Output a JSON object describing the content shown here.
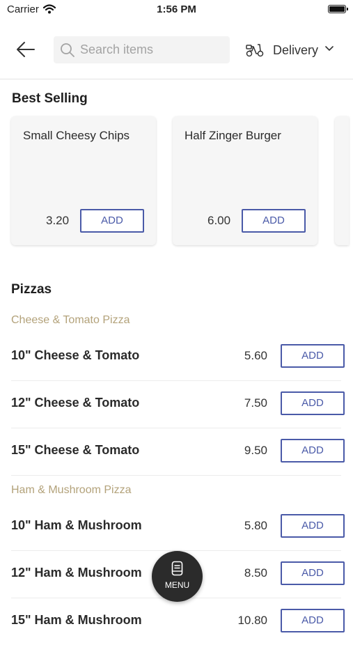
{
  "status_bar": {
    "carrier": "Carrier",
    "time": "1:56 PM"
  },
  "header": {
    "search_placeholder": "Search items",
    "delivery_label": "Delivery"
  },
  "best_selling": {
    "title": "Best Selling",
    "items": [
      {
        "name": "Small Cheesy Chips",
        "price": "3.20",
        "add_label": "ADD"
      },
      {
        "name": "Half Zinger Burger",
        "price": "6.00",
        "add_label": "ADD"
      }
    ]
  },
  "pizzas": {
    "title": "Pizzas",
    "groups": [
      {
        "name": "Cheese & Tomato Pizza",
        "items": [
          {
            "name": "10\" Cheese & Tomato",
            "price": "5.60",
            "add_label": "ADD"
          },
          {
            "name": "12\" Cheese & Tomato",
            "price": "7.50",
            "add_label": "ADD"
          },
          {
            "name": "15\" Cheese & Tomato",
            "price": "9.50",
            "add_label": "ADD"
          }
        ]
      },
      {
        "name": "Ham & Mushroom Pizza",
        "items": [
          {
            "name": "10\" Ham & Mushroom",
            "price": "5.80",
            "add_label": "ADD"
          },
          {
            "name": "12\" Ham & Mushroom",
            "price": "8.50",
            "add_label": "ADD"
          },
          {
            "name": "15\" Ham & Mushroom",
            "price": "10.80",
            "add_label": "ADD"
          }
        ]
      }
    ]
  },
  "menu_button": {
    "label": "MENU"
  },
  "colors": {
    "accent": "#4a5aa8",
    "subcategory": "#b3a27a",
    "fab": "#2b2b2b"
  }
}
